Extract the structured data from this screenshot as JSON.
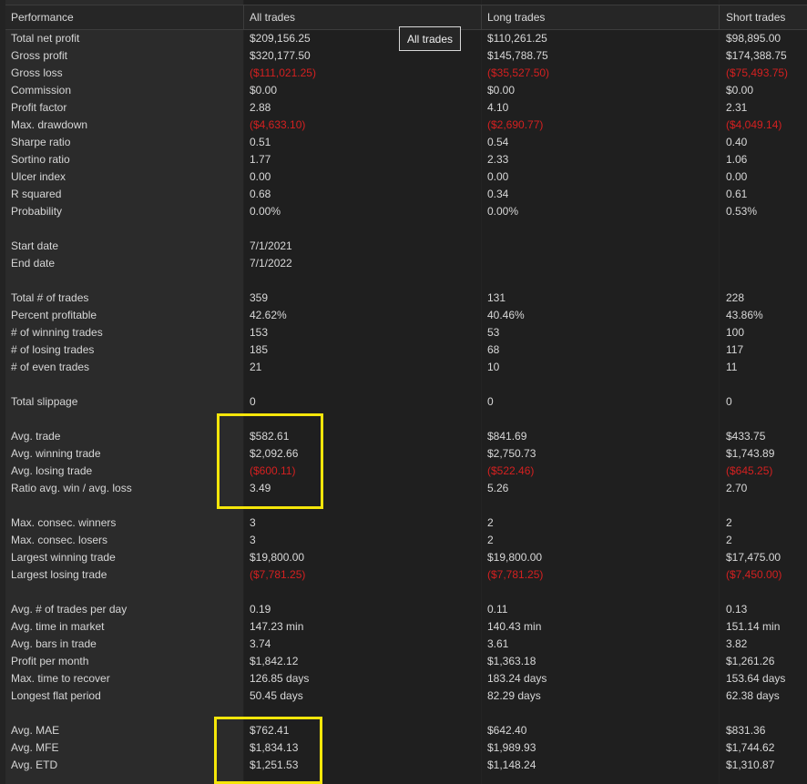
{
  "header": {
    "label": "Performance",
    "all": "All trades",
    "long": "Long trades",
    "short": "Short trades"
  },
  "tooltip": {
    "text": "All trades"
  },
  "colors": {
    "negative": "#d42020",
    "highlight": "#f5e60a",
    "background": "#1f1f1f"
  },
  "rows": [
    {
      "label": "Total net profit",
      "all": "$209,156.25",
      "long": "$110,261.25",
      "short": "$98,895.00"
    },
    {
      "label": "Gross profit",
      "all": "$320,177.50",
      "long": "$145,788.75",
      "short": "$174,388.75"
    },
    {
      "label": "Gross loss",
      "all": "($111,021.25)",
      "long": "($35,527.50)",
      "short": "($75,493.75)",
      "neg": true
    },
    {
      "label": "Commission",
      "all": "$0.00",
      "long": "$0.00",
      "short": "$0.00"
    },
    {
      "label": "Profit factor",
      "all": "2.88",
      "long": "4.10",
      "short": "2.31"
    },
    {
      "label": "Max. drawdown",
      "all": "($4,633.10)",
      "long": "($2,690.77)",
      "short": "($4,049.14)",
      "neg": true
    },
    {
      "label": "Sharpe ratio",
      "all": "0.51",
      "long": "0.54",
      "short": "0.40"
    },
    {
      "label": "Sortino ratio",
      "all": "1.77",
      "long": "2.33",
      "short": "1.06"
    },
    {
      "label": "Ulcer index",
      "all": "0.00",
      "long": "0.00",
      "short": "0.00"
    },
    {
      "label": "R squared",
      "all": "0.68",
      "long": "0.34",
      "short": "0.61"
    },
    {
      "label": "Probability",
      "all": "0.00%",
      "long": "0.00%",
      "short": "0.53%"
    },
    {
      "label": "",
      "all": "",
      "long": "",
      "short": ""
    },
    {
      "label": "Start date",
      "all": "7/1/2021",
      "long": "",
      "short": ""
    },
    {
      "label": "End date",
      "all": "7/1/2022",
      "long": "",
      "short": ""
    },
    {
      "label": "",
      "all": "",
      "long": "",
      "short": ""
    },
    {
      "label": "Total # of trades",
      "all": "359",
      "long": "131",
      "short": "228"
    },
    {
      "label": "Percent profitable",
      "all": "42.62%",
      "long": "40.46%",
      "short": "43.86%"
    },
    {
      "label": "# of winning trades",
      "all": "153",
      "long": "53",
      "short": "100"
    },
    {
      "label": "# of losing trades",
      "all": "185",
      "long": "68",
      "short": "117"
    },
    {
      "label": "# of even trades",
      "all": "21",
      "long": "10",
      "short": "11"
    },
    {
      "label": "",
      "all": "",
      "long": "",
      "short": ""
    },
    {
      "label": "Total slippage",
      "all": "0",
      "long": "0",
      "short": "0"
    },
    {
      "label": "",
      "all": "",
      "long": "",
      "short": ""
    },
    {
      "label": "Avg. trade",
      "all": "$582.61",
      "long": "$841.69",
      "short": "$433.75"
    },
    {
      "label": "Avg. winning trade",
      "all": "$2,092.66",
      "long": "$2,750.73",
      "short": "$1,743.89"
    },
    {
      "label": "Avg. losing trade",
      "all": "($600.11)",
      "long": "($522.46)",
      "short": "($645.25)",
      "neg": true
    },
    {
      "label": "Ratio avg. win / avg. loss",
      "all": "3.49",
      "long": "5.26",
      "short": "2.70"
    },
    {
      "label": "",
      "all": "",
      "long": "",
      "short": ""
    },
    {
      "label": "Max. consec. winners",
      "all": "3",
      "long": "2",
      "short": "2"
    },
    {
      "label": "Max. consec. losers",
      "all": "3",
      "long": "2",
      "short": "2"
    },
    {
      "label": "Largest winning trade",
      "all": "$19,800.00",
      "long": "$19,800.00",
      "short": "$17,475.00"
    },
    {
      "label": "Largest losing trade",
      "all": "($7,781.25)",
      "long": "($7,781.25)",
      "short": "($7,450.00)",
      "neg": true
    },
    {
      "label": "",
      "all": "",
      "long": "",
      "short": ""
    },
    {
      "label": "Avg. # of trades per day",
      "all": "0.19",
      "long": "0.11",
      "short": "0.13"
    },
    {
      "label": "Avg. time in market",
      "all": "147.23 min",
      "long": "140.43 min",
      "short": "151.14 min"
    },
    {
      "label": "Avg. bars in trade",
      "all": "3.74",
      "long": "3.61",
      "short": "3.82"
    },
    {
      "label": "Profit per month",
      "all": "$1,842.12",
      "long": "$1,363.18",
      "short": "$1,261.26"
    },
    {
      "label": "Max. time to recover",
      "all": "126.85 days",
      "long": "183.24 days",
      "short": "153.64 days"
    },
    {
      "label": "Longest flat period",
      "all": "50.45 days",
      "long": "82.29 days",
      "short": "62.38 days"
    },
    {
      "label": "",
      "all": "",
      "long": "",
      "short": ""
    },
    {
      "label": "Avg. MAE",
      "all": "$762.41",
      "long": "$642.40",
      "short": "$831.36"
    },
    {
      "label": "Avg. MFE",
      "all": "$1,834.13",
      "long": "$1,989.93",
      "short": "$1,744.62"
    },
    {
      "label": "Avg. ETD",
      "all": "$1,251.53",
      "long": "$1,148.24",
      "short": "$1,310.87"
    }
  ]
}
